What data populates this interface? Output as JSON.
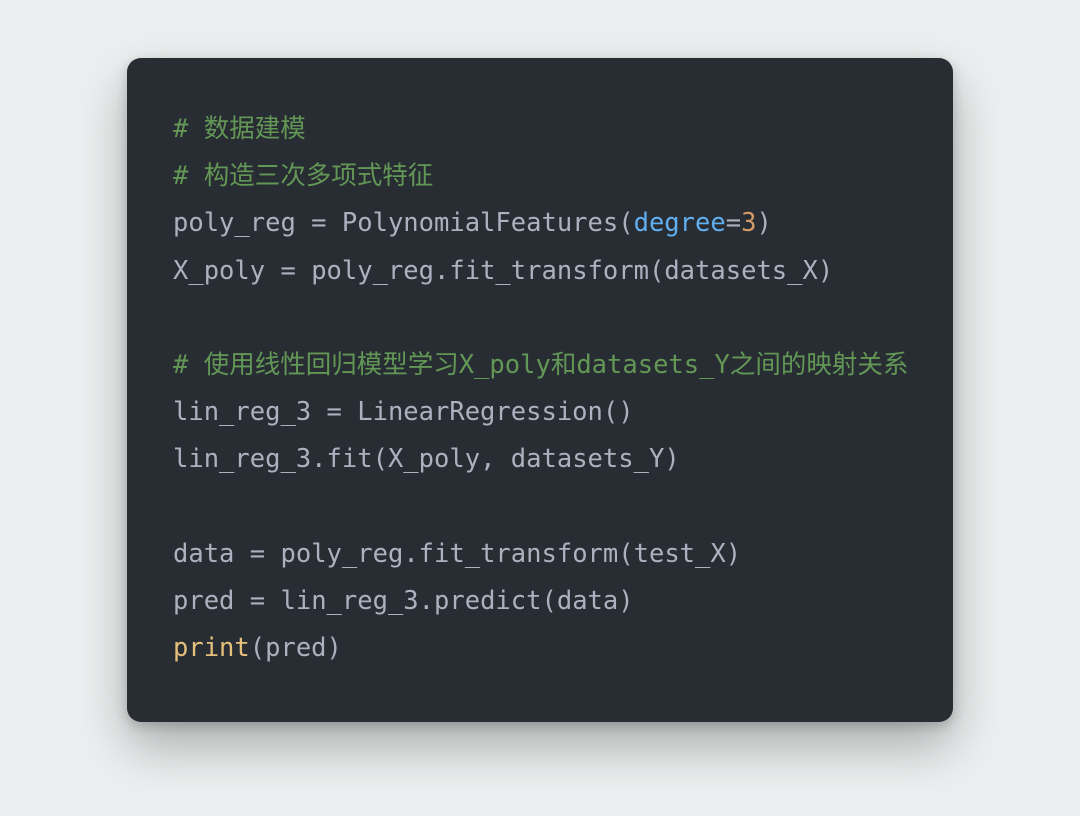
{
  "code": {
    "lines": [
      {
        "type": "comment",
        "prefix": "# ",
        "text": "数据建模"
      },
      {
        "type": "comment",
        "prefix": "# ",
        "text": "构造三次多项式特征"
      },
      {
        "type": "stmt",
        "tokens": [
          {
            "t": "ident",
            "v": "poly_reg"
          },
          {
            "t": "op",
            "v": " = "
          },
          {
            "t": "func",
            "v": "PolynomialFeatures"
          },
          {
            "t": "paren",
            "v": "("
          },
          {
            "t": "kwarg",
            "v": "degree"
          },
          {
            "t": "op",
            "v": "="
          },
          {
            "t": "num",
            "v": "3"
          },
          {
            "t": "paren",
            "v": ")"
          }
        ]
      },
      {
        "type": "stmt",
        "tokens": [
          {
            "t": "ident",
            "v": "X_poly"
          },
          {
            "t": "op",
            "v": " = "
          },
          {
            "t": "ident",
            "v": "poly_reg"
          },
          {
            "t": "op",
            "v": "."
          },
          {
            "t": "func",
            "v": "fit_transform"
          },
          {
            "t": "paren",
            "v": "("
          },
          {
            "t": "ident",
            "v": "datasets_X"
          },
          {
            "t": "paren",
            "v": ")"
          }
        ]
      },
      {
        "type": "blank"
      },
      {
        "type": "comment",
        "prefix": "# ",
        "text": "使用线性回归模型学习X_poly和datasets_Y之间的映射关系"
      },
      {
        "type": "stmt",
        "tokens": [
          {
            "t": "ident",
            "v": "lin_reg_3"
          },
          {
            "t": "op",
            "v": " = "
          },
          {
            "t": "func",
            "v": "LinearRegression"
          },
          {
            "t": "paren",
            "v": "()"
          }
        ]
      },
      {
        "type": "stmt",
        "tokens": [
          {
            "t": "ident",
            "v": "lin_reg_3"
          },
          {
            "t": "op",
            "v": "."
          },
          {
            "t": "func",
            "v": "fit"
          },
          {
            "t": "paren",
            "v": "("
          },
          {
            "t": "ident",
            "v": "X_poly"
          },
          {
            "t": "op",
            "v": ", "
          },
          {
            "t": "ident",
            "v": "datasets_Y"
          },
          {
            "t": "paren",
            "v": ")"
          }
        ]
      },
      {
        "type": "blank"
      },
      {
        "type": "stmt",
        "tokens": [
          {
            "t": "ident",
            "v": "data"
          },
          {
            "t": "op",
            "v": " = "
          },
          {
            "t": "ident",
            "v": "poly_reg"
          },
          {
            "t": "op",
            "v": "."
          },
          {
            "t": "func",
            "v": "fit_transform"
          },
          {
            "t": "paren",
            "v": "("
          },
          {
            "t": "ident",
            "v": "test_X"
          },
          {
            "t": "paren",
            "v": ")"
          }
        ]
      },
      {
        "type": "stmt",
        "tokens": [
          {
            "t": "ident",
            "v": "pred"
          },
          {
            "t": "op",
            "v": " = "
          },
          {
            "t": "ident",
            "v": "lin_reg_3"
          },
          {
            "t": "op",
            "v": "."
          },
          {
            "t": "func",
            "v": "predict"
          },
          {
            "t": "paren",
            "v": "("
          },
          {
            "t": "ident",
            "v": "data"
          },
          {
            "t": "paren",
            "v": ")"
          }
        ]
      },
      {
        "type": "stmt",
        "tokens": [
          {
            "t": "builtin",
            "v": "print"
          },
          {
            "t": "paren",
            "v": "("
          },
          {
            "t": "ident",
            "v": "pred"
          },
          {
            "t": "paren",
            "v": ")"
          }
        ]
      }
    ]
  },
  "colors": {
    "bg": "#eceeef",
    "card": "#282c33",
    "comment": "#629755",
    "ident": "#abb2bf",
    "kwarg": "#61afef",
    "num": "#d19a66",
    "builtin": "#e5c07b"
  }
}
